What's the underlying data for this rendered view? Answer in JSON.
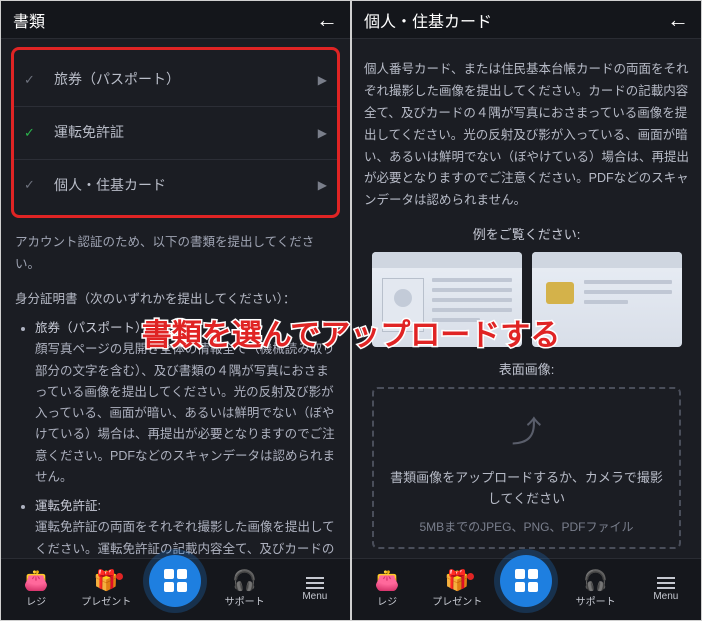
{
  "left": {
    "title": "書類",
    "docs": [
      {
        "label": "旅券（パスポート）",
        "checked": false
      },
      {
        "label": "運転免許証",
        "checked": true
      },
      {
        "label": "個人・住基カード",
        "checked": false
      }
    ],
    "intro": "アカウント認証のため、以下の書類を提出してください。",
    "id_heading": "身分証明書（次のいずれかを提出してください）：",
    "bullets": [
      {
        "title": "旅券（パスポート）",
        "body": "顔写真ページの見開き全体の情報全て（機械読み取り部分の文字を含む）、及び書類の４隅が写真におさまっている画像を提出してください。光の反射及び影が入っている、画面が暗い、あるいは鮮明でない（ぼやけている）場合は、再提出が必要となりますのでご注意ください。PDFなどのスキャンデータは認められません。"
      },
      {
        "title": "運転免許証:",
        "body": "運転免許証の両面をそれぞれ撮影した画像を提出してください。運転免許証の記載内容全て、及びカードの４隅が写真におさまっている画像を提出してください。光の反射及び影が入って"
      }
    ]
  },
  "right": {
    "title": "個人・住基カード",
    "instruction": "個人番号カード、または住民基本台帳カードの両面をそれぞれ撮影した画像を提出してください。カードの記載内容全て、及びカードの４隅が写真におさまっている画像を提出してください。光の反射及び影が入っている、画面が暗い、あるいは鮮明でない（ぼやけている）場合は、再提出が必要となりますのでご注意ください。PDFなどのスキャンデータは認められません。",
    "example_label": "例をご覧ください:",
    "upload_section": "表面画像:",
    "dropzone_main": "書類画像をアップロードするか、カメラで撮影してください",
    "dropzone_sub": "5MBまでのJPEG、PNG、PDFファイル"
  },
  "nav": {
    "cashier": "レジ",
    "present": "プレゼント",
    "support": "サポート",
    "menu": "Menu"
  },
  "annotation": "書類を選んでアップロードする"
}
